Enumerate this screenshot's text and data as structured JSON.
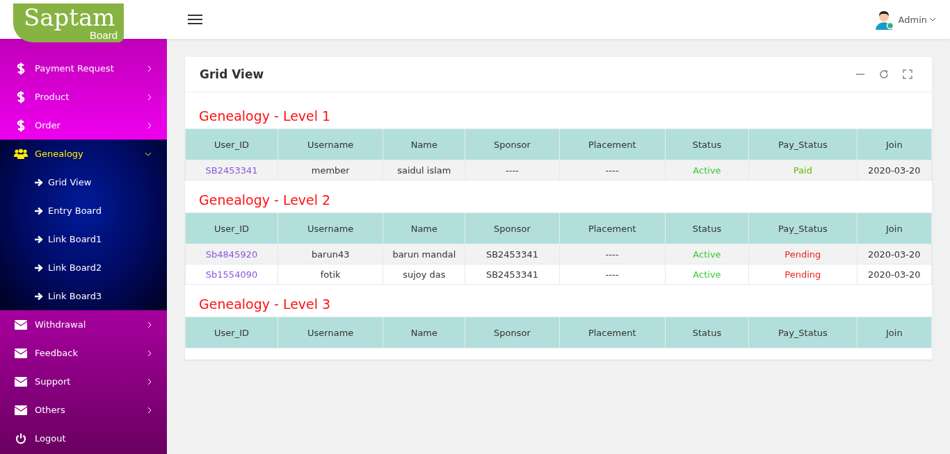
{
  "logo": {
    "title": "Saptam",
    "subtitle": "Board"
  },
  "header": {
    "user": "Admin"
  },
  "sidebar": {
    "items": [
      {
        "label": "Payment Request",
        "kind": "dollar",
        "expanded": false
      },
      {
        "label": "Product",
        "kind": "dollar",
        "expanded": false
      },
      {
        "label": "Order",
        "kind": "dollar",
        "expanded": false
      },
      {
        "label": "Genealogy",
        "kind": "users",
        "expanded": true,
        "children": [
          {
            "label": "Grid View"
          },
          {
            "label": "Entry Board"
          },
          {
            "label": "Link Board1"
          },
          {
            "label": "Link Board2"
          },
          {
            "label": "Link Board3"
          }
        ]
      },
      {
        "label": "Withdrawal",
        "kind": "mail",
        "expanded": false
      },
      {
        "label": "Feedback",
        "kind": "mail",
        "expanded": false
      },
      {
        "label": "Support",
        "kind": "mail",
        "expanded": false
      },
      {
        "label": "Others",
        "kind": "mail",
        "expanded": false
      },
      {
        "label": "Logout",
        "kind": "power"
      }
    ]
  },
  "card": {
    "title": "Grid View",
    "levels": [
      {
        "title": "Genealogy - Level 1",
        "columns": [
          "User_ID",
          "Username",
          "Name",
          "Sponsor",
          "Placement",
          "Status",
          "Pay_Status",
          "Join"
        ],
        "rows": [
          {
            "user_id": "SB2453341",
            "username": "member",
            "name": "saidul islam",
            "sponsor": "----",
            "placement": "----",
            "status": {
              "text": "Active",
              "color": "#33cc33"
            },
            "pay_status": {
              "text": "Paid",
              "color": "#66bb00"
            },
            "join": "2020-03-20"
          }
        ]
      },
      {
        "title": "Genealogy - Level 2",
        "columns": [
          "User_ID",
          "Username",
          "Name",
          "Sponsor",
          "Placement",
          "Status",
          "Pay_Status",
          "Join"
        ],
        "rows": [
          {
            "user_id": "Sb4845920",
            "username": "barun43",
            "name": "barun mandal",
            "sponsor": "SB2453341",
            "placement": "----",
            "status": {
              "text": "Active",
              "color": "#33cc33"
            },
            "pay_status": {
              "text": "Pending",
              "color": "#ee2222"
            },
            "join": "2020-03-20"
          },
          {
            "user_id": "Sb1554090",
            "username": "fotik",
            "name": "sujoy das",
            "sponsor": "SB2453341",
            "placement": "----",
            "status": {
              "text": "Active",
              "color": "#33cc33"
            },
            "pay_status": {
              "text": "Pending",
              "color": "#ee2222"
            },
            "join": "2020-03-20"
          }
        ]
      },
      {
        "title": "Genealogy - Level 3",
        "columns": [
          "User_ID",
          "Username",
          "Name",
          "Sponsor",
          "Placement",
          "Status",
          "Pay_Status",
          "Join"
        ]
      }
    ]
  }
}
